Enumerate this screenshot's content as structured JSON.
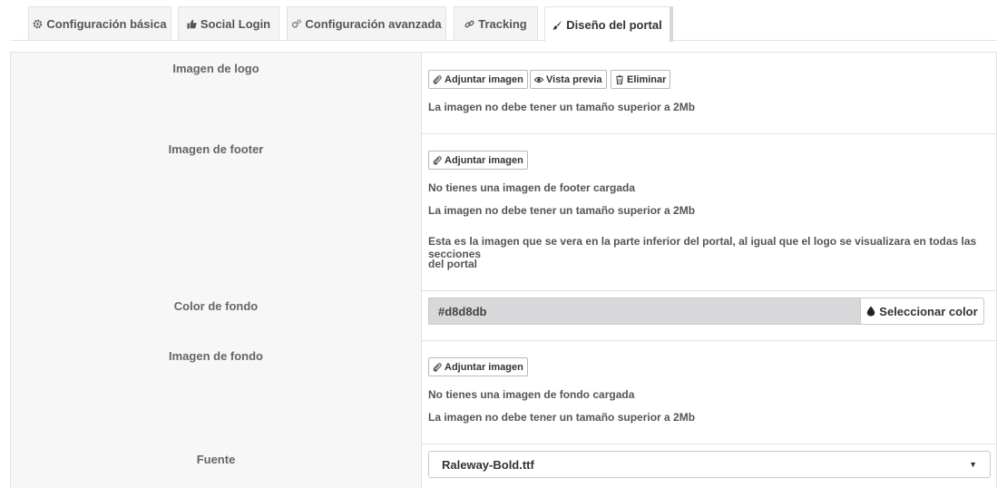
{
  "tabs": [
    {
      "label": "Configuración básica",
      "icon": "gear-icon",
      "active": false
    },
    {
      "label": "Social Login",
      "icon": "thumbs-up-icon",
      "active": false
    },
    {
      "label": "Configuración avanzada",
      "icon": "gears-icon",
      "active": false
    },
    {
      "label": "Tracking",
      "icon": "link-icon",
      "active": false
    },
    {
      "label": "Diseño del portal",
      "icon": "paintbrush-icon",
      "active": true
    }
  ],
  "logo": {
    "label": "Imagen de logo",
    "attach_label": "Adjuntar imagen",
    "preview_label": "Vista previa",
    "delete_label": "Eliminar",
    "size_note": "La imagen no debe tener un tamaño superior a 2Mb"
  },
  "footer": {
    "label": "Imagen de footer",
    "attach_label": "Adjuntar imagen",
    "status": "No tienes una imagen de footer cargada",
    "size_note": "La imagen no debe tener un tamaño superior a 2Mb",
    "help_line1": "Esta es la imagen que se vera en la parte inferior del portal, al igual que el logo se visualizara en todas las secciones",
    "help_line2": "del portal"
  },
  "bg_color": {
    "label": "Color de fondo",
    "value": "#d8d8db",
    "button_label": "Seleccionar color",
    "swatch": "#d8d8db"
  },
  "bg_image": {
    "label": "Imagen de fondo",
    "attach_label": "Adjuntar imagen",
    "status": "No tienes una imagen de fondo cargada",
    "size_note": "La imagen no debe tener un tamaño superior a 2Mb"
  },
  "font": {
    "label": "Fuente",
    "selected": "Raleway-Bold.ttf"
  }
}
